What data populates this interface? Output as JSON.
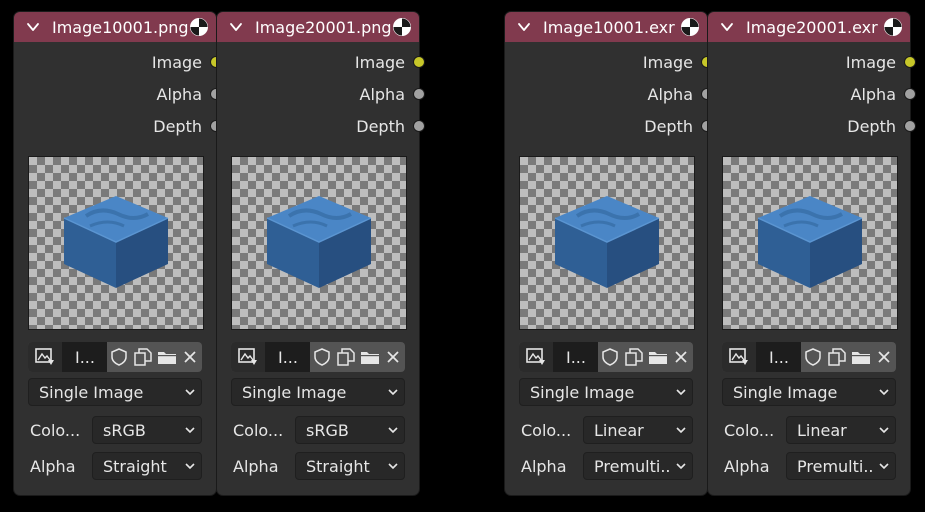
{
  "nodes": [
    {
      "title": "Image10001.png",
      "outputs": {
        "image": "Image",
        "alpha": "Alpha",
        "depth": "Depth"
      },
      "image_name": "I...",
      "source": "Single Image",
      "color_label": "Colo...",
      "color_space": "sRGB",
      "alpha_label": "Alpha",
      "alpha_mode": "Straight"
    },
    {
      "title": "Image20001.png",
      "outputs": {
        "image": "Image",
        "alpha": "Alpha",
        "depth": "Depth"
      },
      "image_name": "I...",
      "source": "Single Image",
      "color_label": "Colo...",
      "color_space": "sRGB",
      "alpha_label": "Alpha",
      "alpha_mode": "Straight"
    },
    {
      "title": "Image10001.exr",
      "outputs": {
        "image": "Image",
        "alpha": "Alpha",
        "depth": "Depth"
      },
      "image_name": "I...",
      "source": "Single Image",
      "color_label": "Colo...",
      "color_space": "Linear",
      "alpha_label": "Alpha",
      "alpha_mode": "Premulti..."
    },
    {
      "title": "Image20001.exr",
      "outputs": {
        "image": "Image",
        "alpha": "Alpha",
        "depth": "Depth"
      },
      "image_name": "I...",
      "source": "Single Image",
      "color_label": "Colo...",
      "color_space": "Linear",
      "alpha_label": "Alpha",
      "alpha_mode": "Premulti..."
    }
  ],
  "colors": {
    "header": "#813a4e",
    "node_body": "#303030",
    "socket_color": "#c7c729",
    "socket_float": "#a1a1a1"
  },
  "icons": [
    "chevron-down-icon",
    "image-datablock-icon",
    "image-browse-icon",
    "fake-user-shield-icon",
    "new-image-icon",
    "open-folder-icon",
    "close-icon"
  ]
}
